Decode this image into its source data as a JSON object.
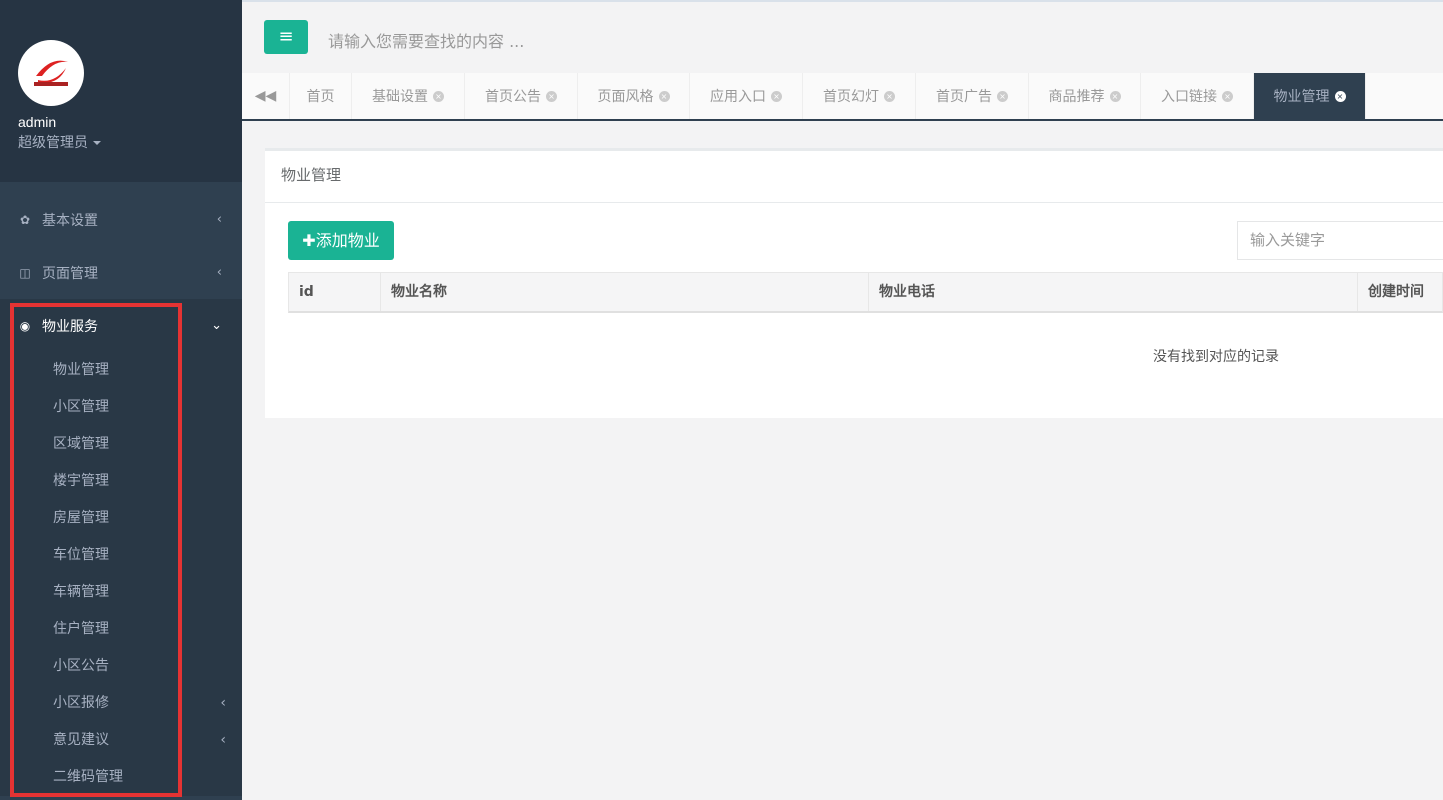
{
  "sidebar": {
    "user": {
      "name": "admin",
      "role": "超级管理员"
    },
    "items": [
      {
        "label": "基本设置",
        "icon": "gear-icon"
      },
      {
        "label": "页面管理",
        "icon": "columns-icon"
      },
      {
        "label": "物业服务",
        "icon": "life-ring-icon"
      }
    ],
    "subitems": [
      "物业管理",
      "小区管理",
      "区域管理",
      "楼宇管理",
      "房屋管理",
      "车位管理",
      "车辆管理",
      "住户管理",
      "小区公告",
      "小区报修",
      "意见建议",
      "二维码管理"
    ]
  },
  "topbar": {
    "search_placeholder": "请输入您需要查找的内容 ..."
  },
  "tabs": [
    "首页",
    "基础设置",
    "首页公告",
    "页面风格",
    "应用入口",
    "首页幻灯",
    "首页广告",
    "商品推荐",
    "入口链接",
    "物业管理"
  ],
  "main": {
    "title": "物业管理",
    "add_label": "添加物业",
    "search_placeholder": "输入关键字",
    "columns": [
      "id",
      "物业名称",
      "物业电话",
      "创建时间"
    ],
    "empty": "没有找到对应的记录"
  },
  "colors": {
    "accent": "#1ab394",
    "sidebar": "#2f4050",
    "highlight": "#e53333"
  }
}
